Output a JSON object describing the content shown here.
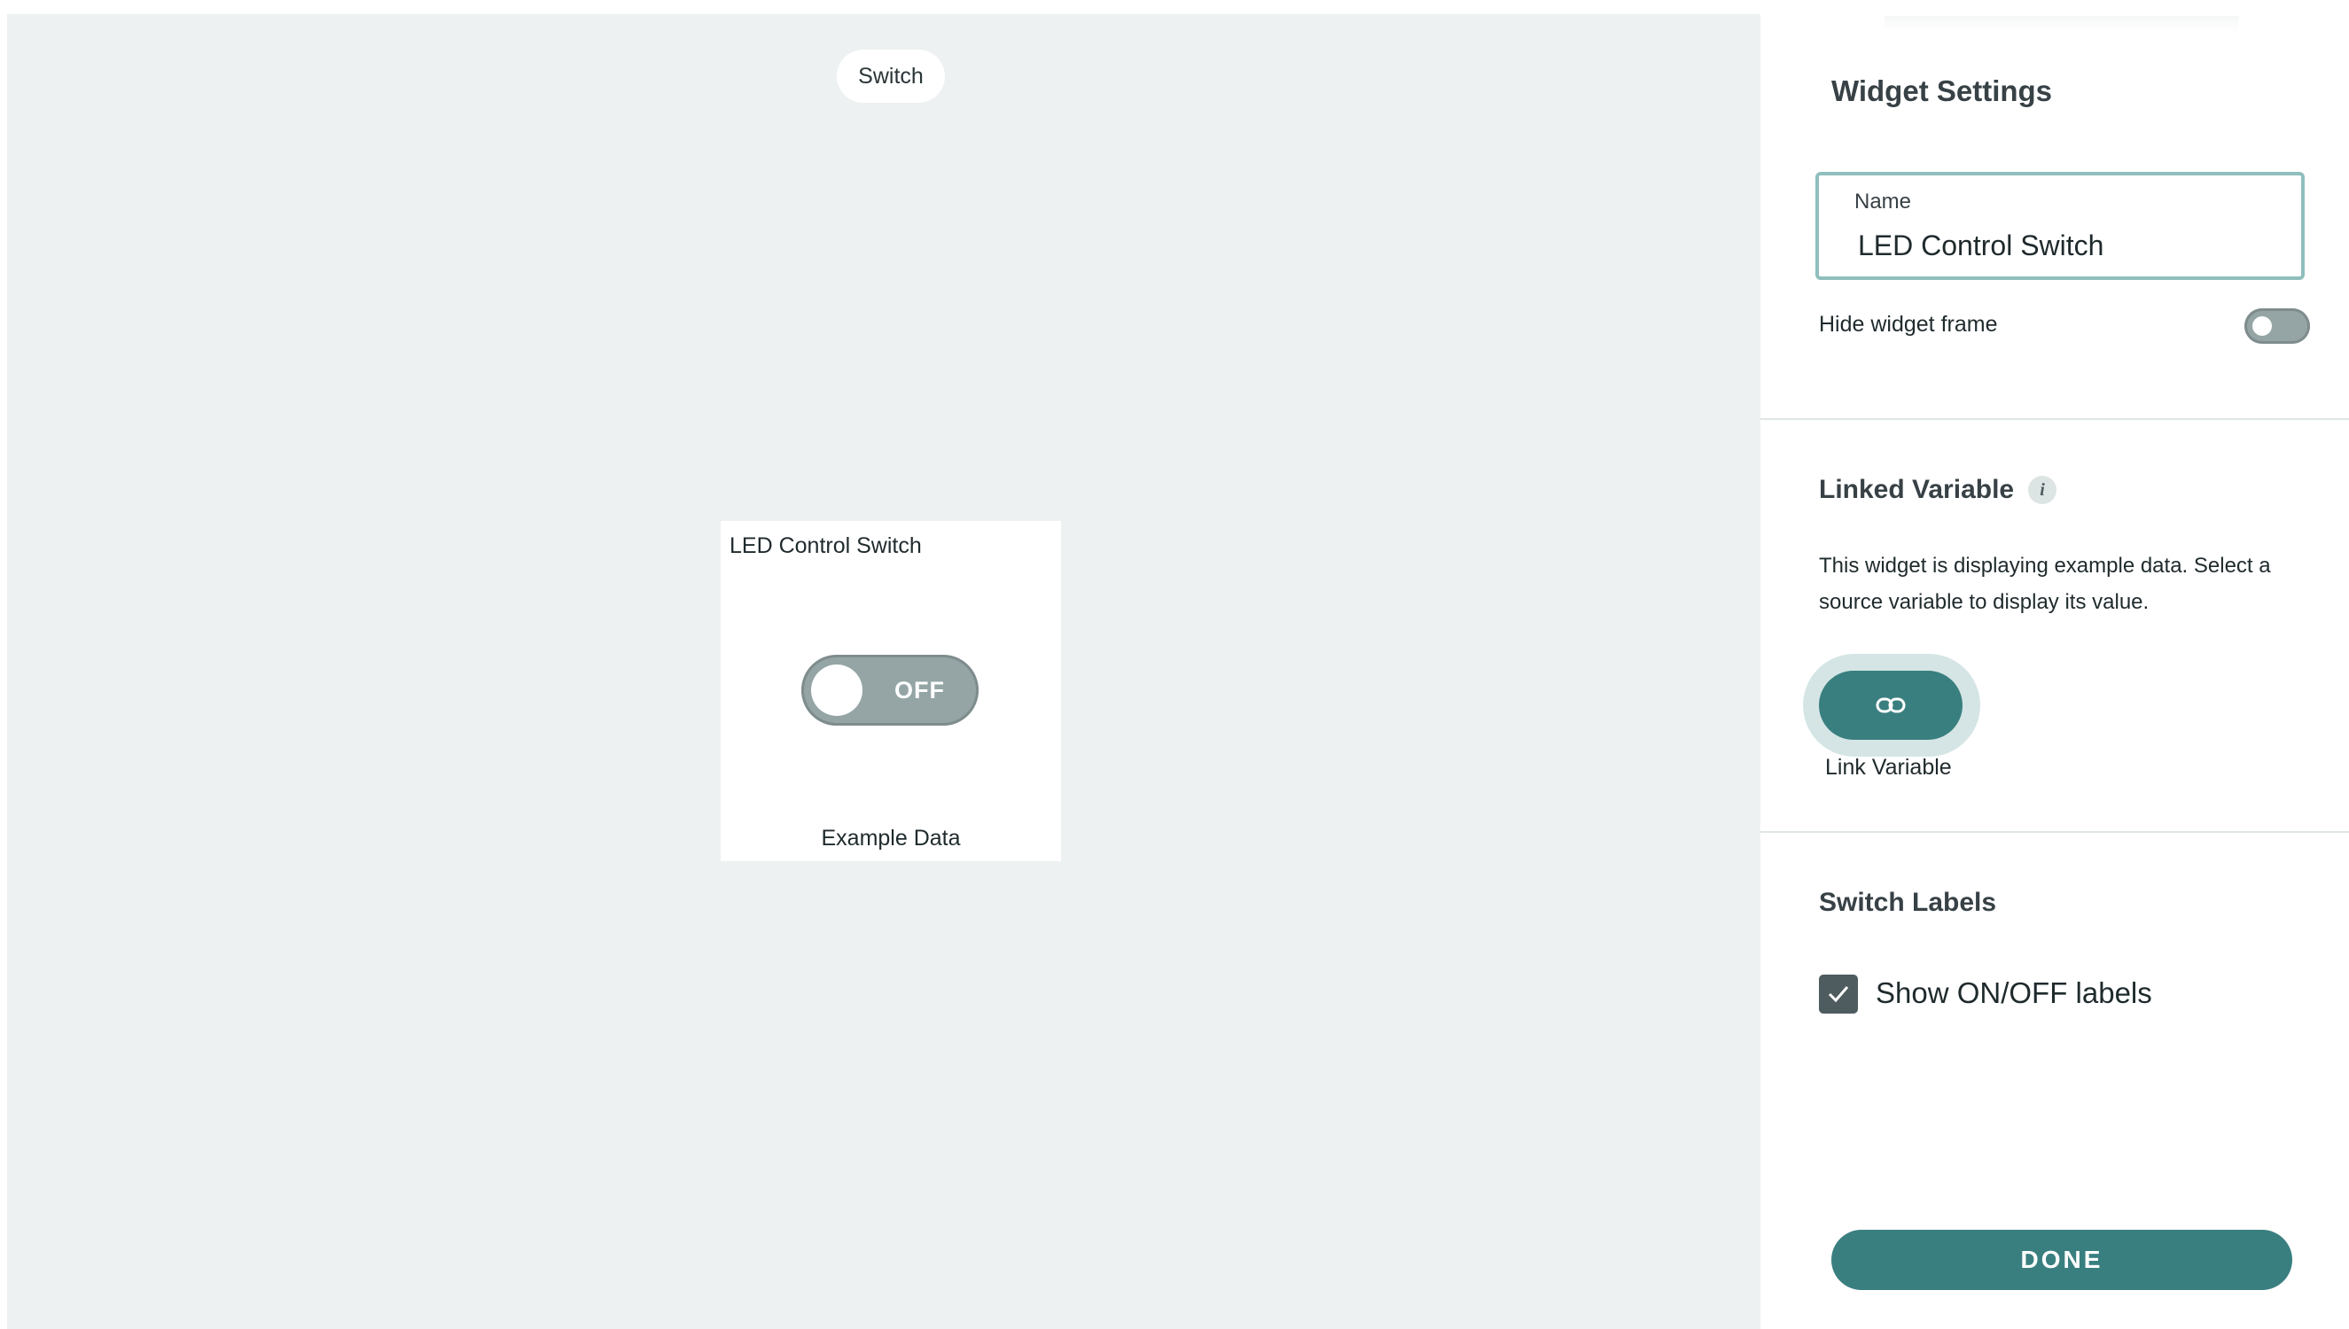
{
  "canvas": {
    "widget_type_label": "Switch",
    "widget": {
      "title": "LED Control Switch",
      "switch_state": "OFF",
      "caption": "Example Data"
    }
  },
  "panel": {
    "heading": "Widget Settings",
    "name_field": {
      "label": "Name",
      "value": "LED Control Switch"
    },
    "hide_frame": {
      "label": "Hide widget frame",
      "enabled": false
    },
    "linked_variable": {
      "title": "Linked Variable",
      "info_icon": "info-icon",
      "description": "This widget is displaying example data. Select a source variable to display its value.",
      "button_icon": "link-icon",
      "button_label": "Link Variable"
    },
    "switch_labels": {
      "title": "Switch Labels",
      "checkbox_label": "Show ON/OFF labels",
      "checked": true
    },
    "done_label": "DONE"
  },
  "colors": {
    "accent": "#3a7f80",
    "canvas_bg": "#edf1f1",
    "toggle_off": "#95a5a6"
  }
}
